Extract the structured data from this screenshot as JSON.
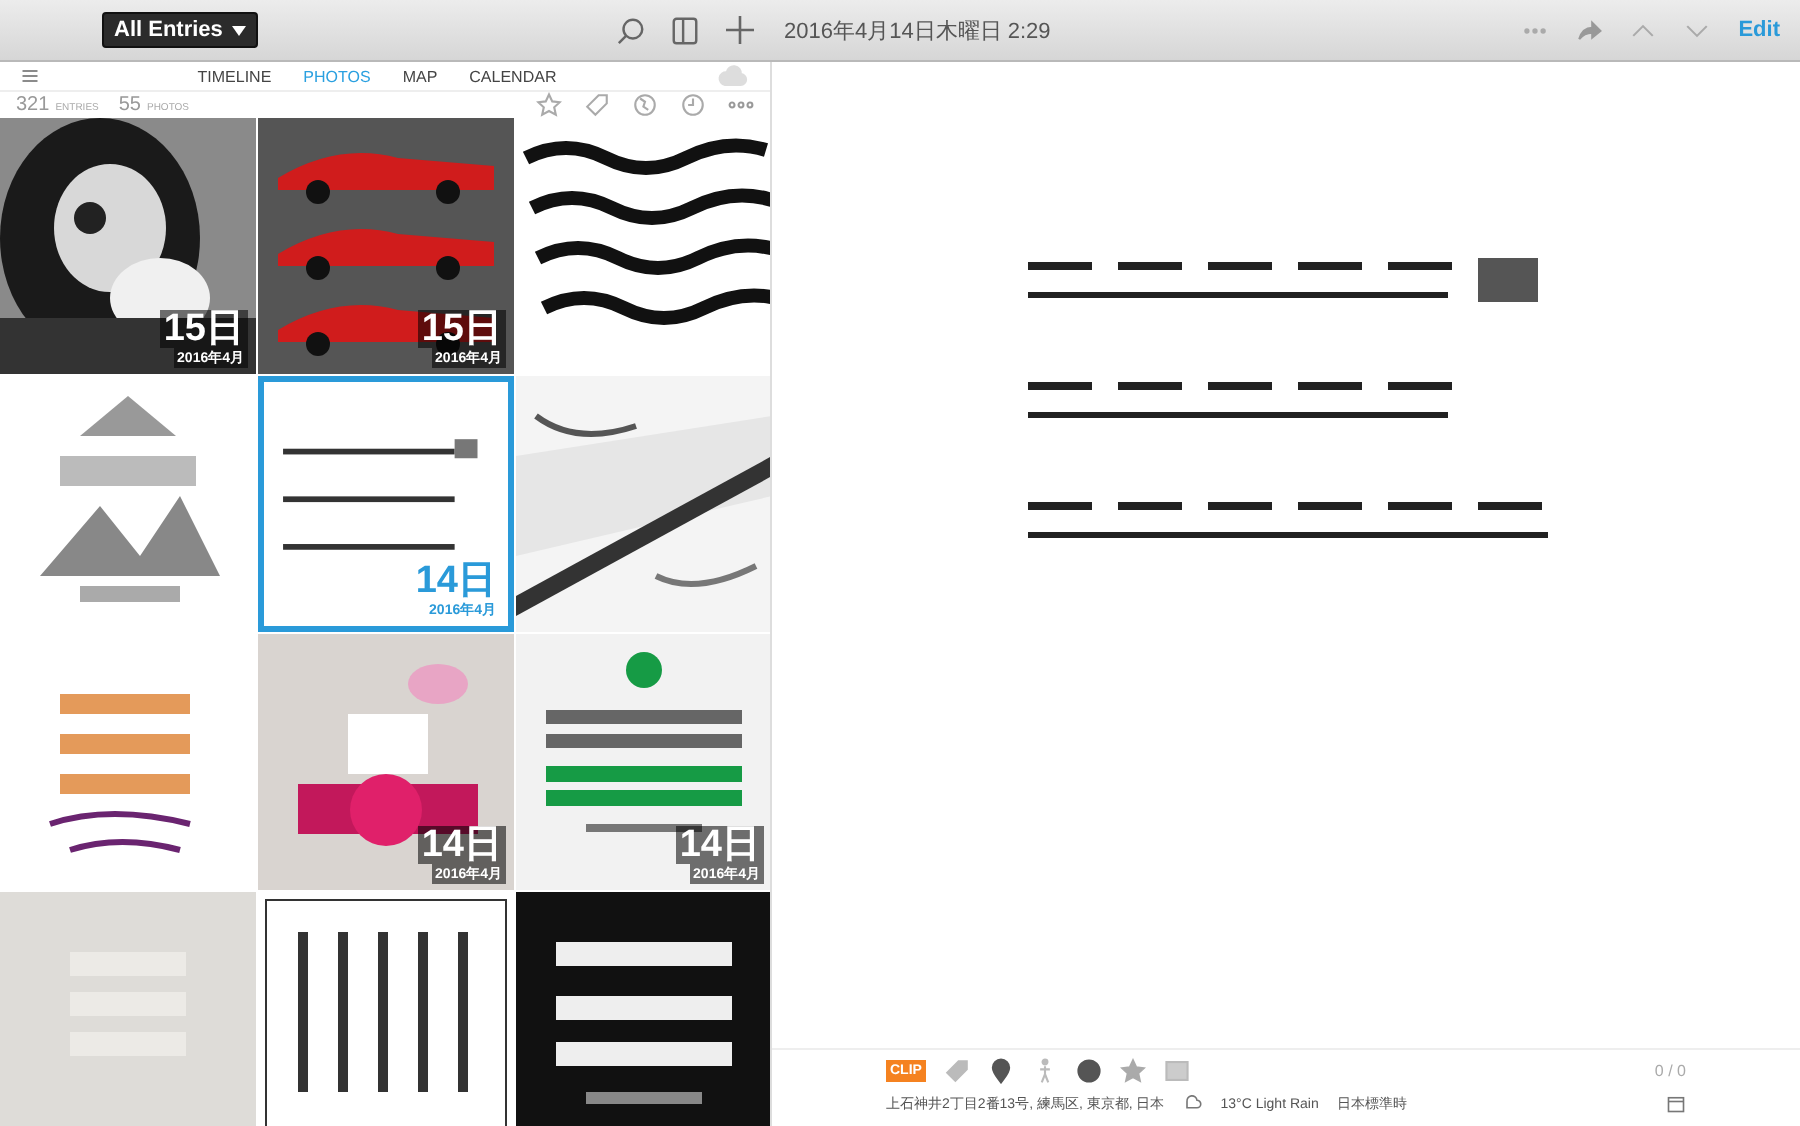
{
  "toolbar": {
    "journal_menu": "All Entries",
    "date": "2016年4月14日木曜日 2:29",
    "edit": "Edit"
  },
  "nav": {
    "tabs": [
      {
        "label": "TIMELINE",
        "selected": false
      },
      {
        "label": "PHOTOS",
        "selected": true
      },
      {
        "label": "MAP",
        "selected": false
      },
      {
        "label": "CALENDAR",
        "selected": false
      }
    ]
  },
  "stats": [
    {
      "count": "321",
      "unit": "ENTRIES"
    },
    {
      "count": "55",
      "unit": "PHOTOS"
    }
  ],
  "photos": [
    {
      "kind": "picture",
      "selected": false,
      "day": "15日",
      "month": "2016年4月"
    },
    {
      "kind": "picture",
      "selected": false,
      "day": "15日",
      "month": "2016年4月"
    },
    {
      "kind": "picture",
      "selected": false
    },
    {
      "kind": "picture",
      "selected": false
    },
    {
      "kind": "picture",
      "selected": true,
      "day": "14日",
      "month": "2016年4月"
    },
    {
      "kind": "picture",
      "selected": false
    },
    {
      "kind": "picture",
      "selected": false
    },
    {
      "kind": "picture",
      "selected": false,
      "day": "14日",
      "month": "2016年4月"
    },
    {
      "kind": "picture",
      "selected": false,
      "day": "14日",
      "month": "2016年4月"
    },
    {
      "kind": "picture",
      "selected": false
    },
    {
      "kind": "picture",
      "selected": false
    },
    {
      "kind": "picture",
      "selected": false
    }
  ],
  "entry": {
    "photo": {
      "kind": "picture"
    },
    "clip": "CLIP",
    "counter": "0 / 0",
    "location": "上石神井2丁目2番13号, 練馬区, 東京都, 日本",
    "weather": "13°C Light Rain",
    "timezone": "日本標準時"
  }
}
